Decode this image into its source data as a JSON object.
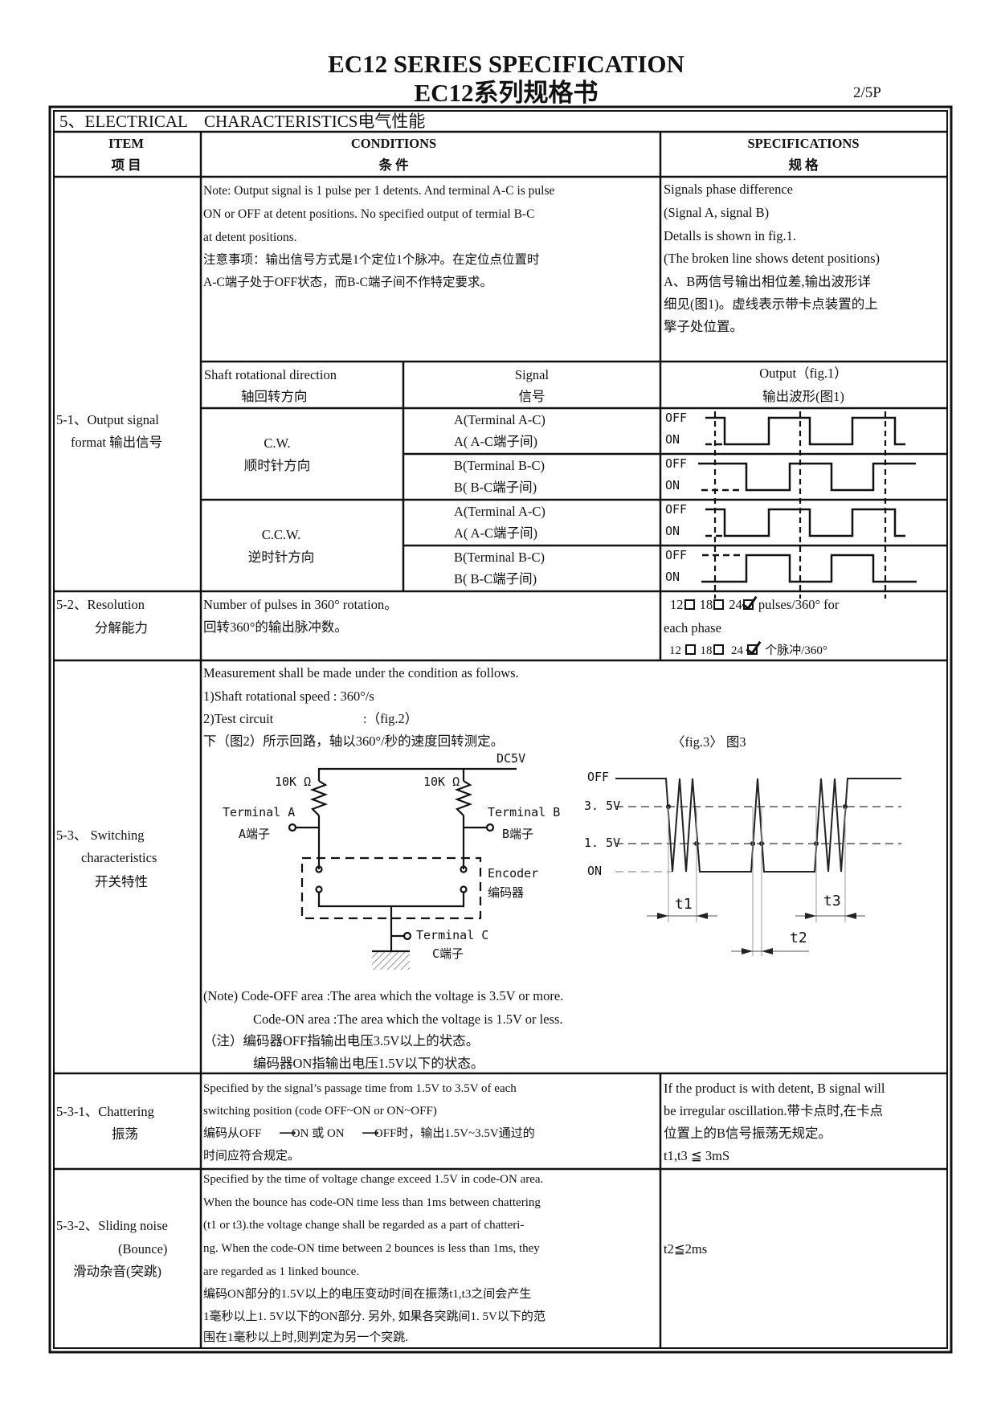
{
  "header": {
    "title_en": "EC12  SERIES SPECIFICATION",
    "title_cn": "EC12系列规格书",
    "page": "2/5P"
  },
  "section": {
    "title": "5、ELECTRICAL　CHARACTERISTICS电气性能"
  },
  "columns": {
    "item": {
      "en": "ITEM",
      "cn": "项 目"
    },
    "conditions": {
      "en": "CONDITIONS",
      "cn": "条 件"
    },
    "specifications": {
      "en": "SPECIFICATIONS",
      "cn": "规 格"
    }
  },
  "output_signal": {
    "item": [
      "5-1、Output signal",
      "format 输出信号"
    ],
    "note": [
      "Note: Output signal is 1 pulse per 1 detents. And terminal A-C is pulse",
      "ON or OFF at detent positions. No specified output of termial B-C",
      "at detent positions.",
      "注意事项：输出信号方式是1个定位1个脉冲。在定位点位置时",
      "A-C端子处于OFF状态，而B-C端子间不作特定要求。"
    ],
    "spec": [
      "Signals phase difference",
      "(Signal A, signal B)",
      "Detalls is shown in fig.1.",
      "(The broken line shows detent positions)",
      "A、B两信号输出相位差,输出波形详",
      "细见(图1)。虚线表示带卡点装置的上",
      "擎子处位置。"
    ],
    "sub_headers": {
      "direction": [
        "Shaft rotational direction",
        "轴回转方向"
      ],
      "signal": [
        "Signal",
        "信号"
      ],
      "output": [
        "Output（fig.1）",
        "输出波形(图1)"
      ]
    },
    "directions": [
      {
        "en": "C.W.",
        "cn": "顺时针方向"
      },
      {
        "en": "C.C.W.",
        "cn": "逆时针方向"
      }
    ],
    "signals": [
      [
        "A(Terminal A-C)",
        "A( A-C端子间)"
      ],
      [
        "B(Terminal B-C)",
        "B( B-C端子间)"
      ],
      [
        "A(Terminal A-C)",
        "A( A-C端子间)"
      ],
      [
        "B(Terminal B-C)",
        "B( B-C端子间)"
      ]
    ],
    "levels": {
      "off": "OFF",
      "on": "ON"
    }
  },
  "resolution": {
    "item": [
      "5-2、Resolution",
      "分解能力"
    ],
    "conditions": [
      "Number of pulses in 360°  rotation。",
      "回转360°的输出脉冲数。"
    ],
    "options": [
      {
        "value": "12",
        "checked": false
      },
      {
        "value": "18",
        "checked": false
      },
      {
        "value": "24",
        "checked": true
      }
    ],
    "unit_en": "pulses/360° for",
    "unit_en_2": "each phase",
    "unit_cn": "个脉冲/360°"
  },
  "switching": {
    "item": [
      "5-3、 Switching",
      "characteristics",
      "开关特性"
    ],
    "conditions": [
      "Measurement shall be made under the condition as follows.",
      "1)Shaft rotational speed : 360°/s",
      "2)Test circuit",
      ":（fig.2）",
      "下（图2）所示回路，轴以360°/秒的速度回转测定。"
    ],
    "fig3_caption": "〈fig.3〉 图3",
    "circuit": {
      "supply": "DC5V",
      "resistor": "10K Ω",
      "terminal_a": [
        "Terminal A",
        "A端子"
      ],
      "terminal_b": [
        "Terminal B",
        "B端子"
      ],
      "terminal_c": [
        "Terminal C",
        "C端子"
      ],
      "encoder": [
        "Encoder",
        "编码器"
      ]
    },
    "fig3": {
      "levels": [
        "OFF",
        "3. 5V",
        "1. 5V",
        "ON"
      ],
      "intervals": [
        "t1",
        "t2",
        "t3"
      ]
    },
    "notes": [
      "(Note) Code-OFF area  :The area which the voltage is 3.5V or more.",
      "Code-ON area  :The area which the voltage is 1.5V or less.",
      "（注）编码器OFF指输出电压3.5V以上的状态。",
      "编码器ON指输出电压1.5V以下的状态。"
    ]
  },
  "chattering": {
    "item": [
      "5-3-1、Chattering",
      "振荡"
    ],
    "conditions": [
      "Specified by the signal’s passage time from 1.5V to 3.5V of each",
      " switching position (code OFF~ON or ON~OFF)",
      "时间应符合规定。"
    ],
    "cn_line": {
      "a": "编码从OFF",
      "b": "ON 或 ON",
      "c": "OFF时，输出1.5V~3.5V通过的"
    },
    "spec": [
      "If the product is with detent, B signal will",
      "be irregular oscillation.带卡点时,在卡点",
      "位置上的B信号振荡无规定。",
      "t1,t3 ≦ 3mS"
    ]
  },
  "bounce": {
    "item": [
      "5-3-2、Sliding noise",
      "(Bounce)",
      "滑动杂音(突跳)"
    ],
    "conditions": [
      "Specified by the time of voltage change exceed 1.5V in code-ON area.",
      "When the bounce has code-ON time less than 1ms between chattering",
      "(t1 or t3).the voltage change shall be regarded as a part of chatteri-",
      "ng. When the code-ON time between 2 bounces is less than 1ms, they",
      "are regarded as 1 linked bounce.",
      "编码ON部分的1.5V以上的电压变动时间在振荡t1,t3之间会产生",
      "1毫秒以上1. 5V以下的ON部分. 另外, 如果各突跳间1. 5V以下的范",
      "围在1毫秒以上时,则判定为另一个突跳."
    ],
    "spec": "t2≦2ms"
  }
}
